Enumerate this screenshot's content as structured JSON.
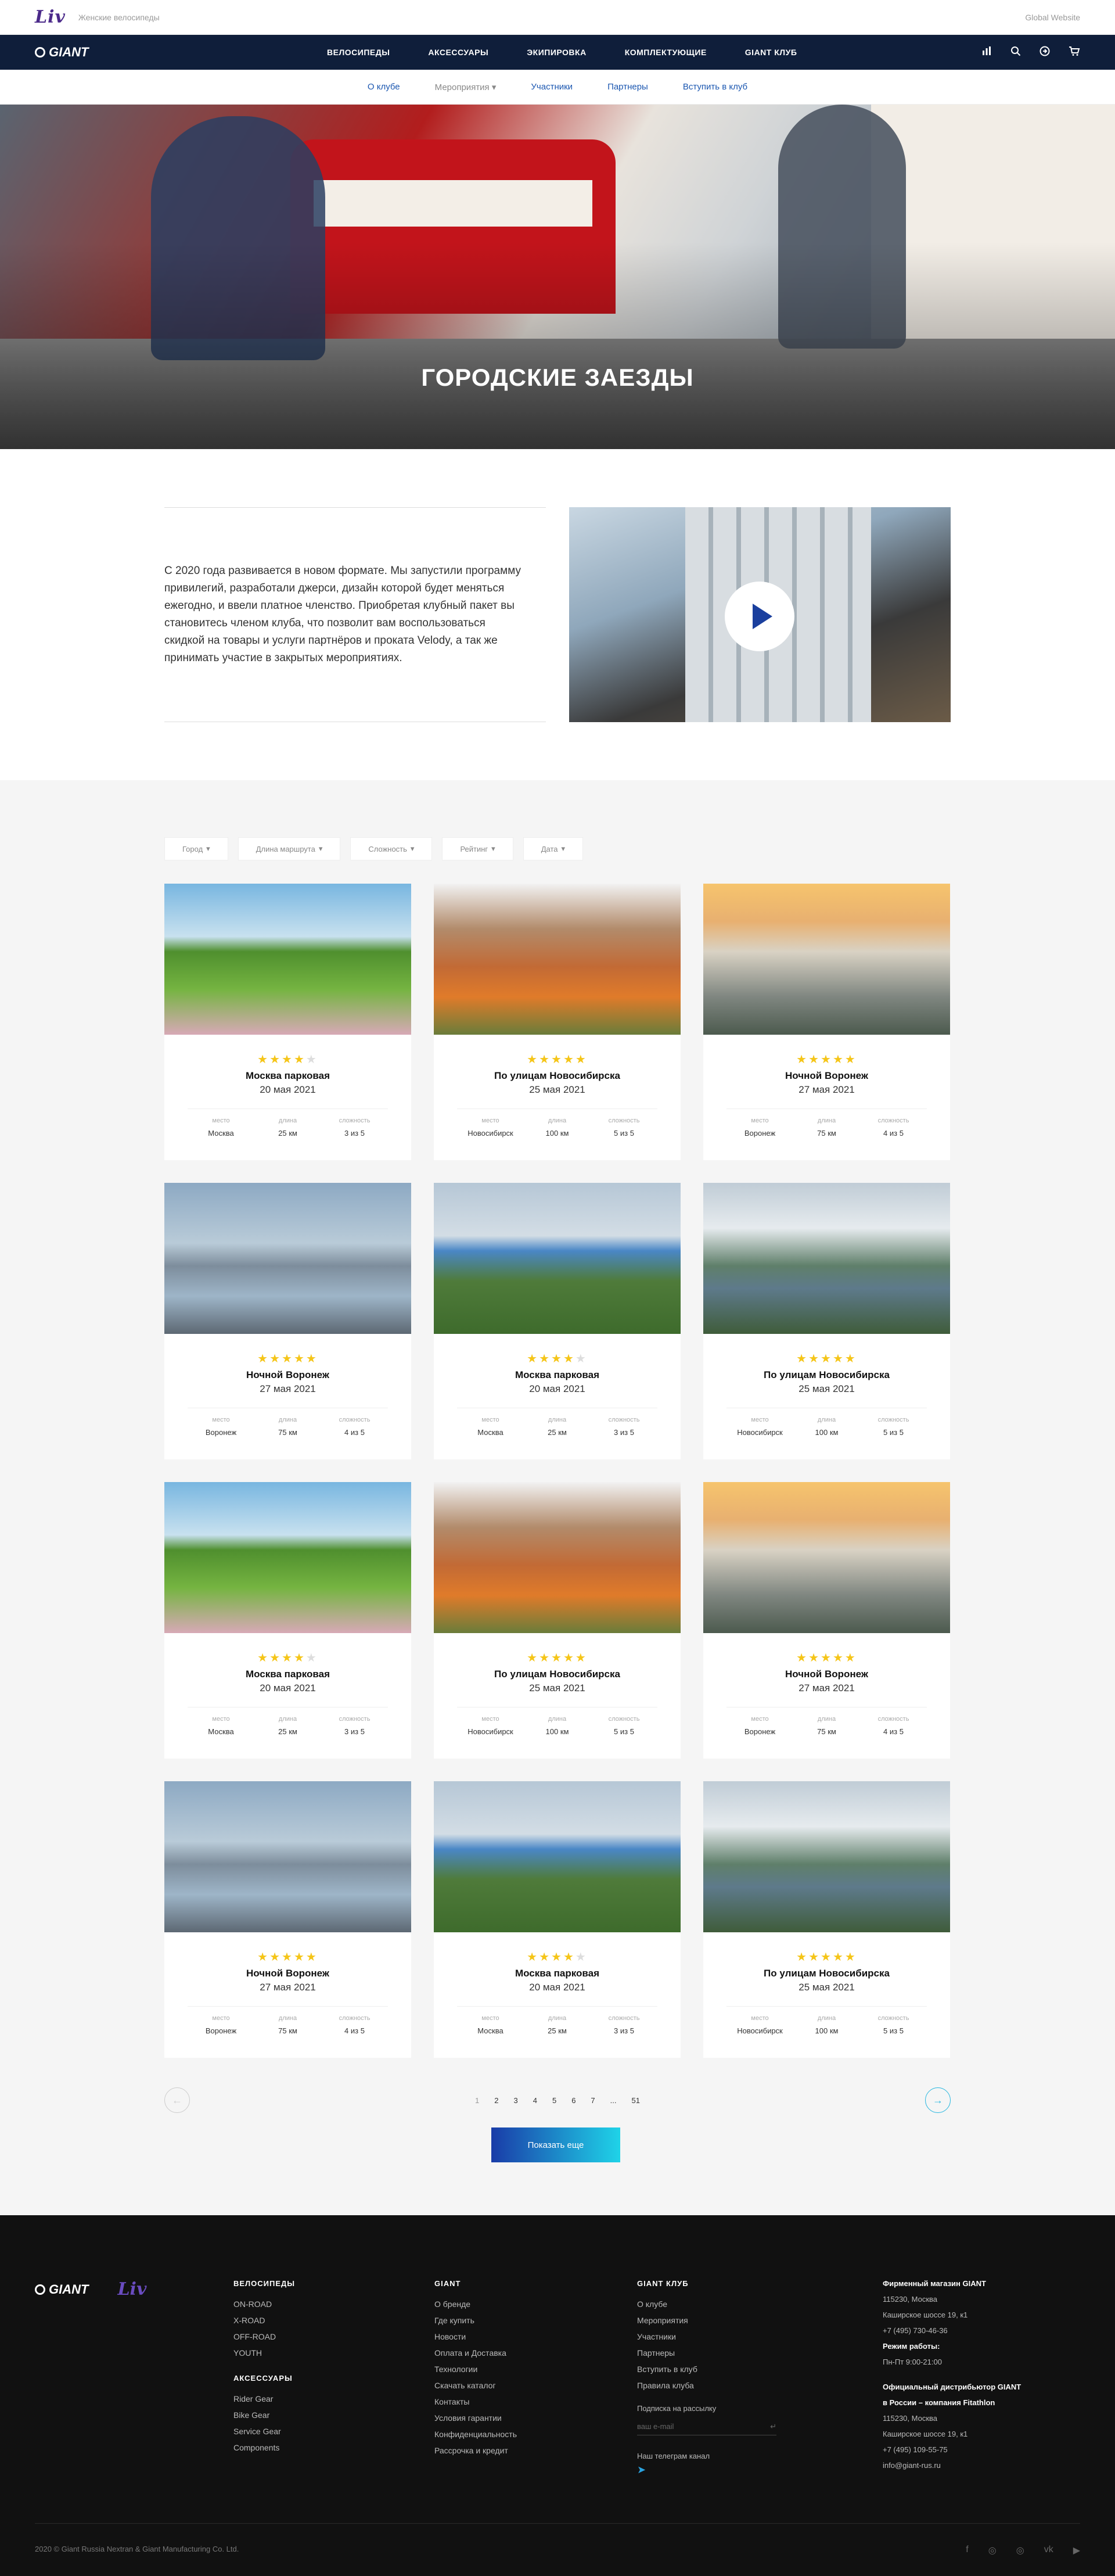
{
  "topbar": {
    "brand": "Liv",
    "subtitle": "Женские велосипеды",
    "global_link": "Global Website"
  },
  "mainnav": {
    "brand": "GIANT",
    "items": [
      "ВЕЛОСИПЕДЫ",
      "АКСЕССУАРЫ",
      "ЭКИПИРОВКА",
      "КОМПЛЕКТУЮЩИЕ",
      "GIANT КЛУБ"
    ],
    "icons": [
      "compare-icon",
      "search-icon",
      "account-icon",
      "cart-icon"
    ]
  },
  "subnav": {
    "items": [
      "О клубе",
      "Мероприятия",
      "Участники",
      "Партнеры",
      "Вступить в клуб"
    ],
    "dropdown_mark": "▾"
  },
  "hero": {
    "title": "ГОРОДСКИЕ ЗАЕЗДЫ"
  },
  "about": {
    "text": "С 2020 года развивается в новом формате. Мы запустили программу привилегий, разработали джерси, дизайн которой будет меняться ежегодно, и ввели платное членство. Приобретая клубный пакет вы становитесь членом клуба, что позволит вам воспользоваться скидкой на товары и услуги партнёров и проката Velody, а так же принимать участие в закрытых мероприятиях."
  },
  "filters": [
    {
      "label": "Город",
      "arrow": "▾"
    },
    {
      "label": "Длина маршрута",
      "arrow": "▾"
    },
    {
      "label": "Сложность",
      "arrow": "▾"
    },
    {
      "label": "Рейтинг",
      "arrow": "▾"
    },
    {
      "label": "Дата",
      "arrow": "▾"
    }
  ],
  "labels": {
    "place": "место",
    "length": "длина",
    "difficulty": "сложность"
  },
  "cards": [
    {
      "image": "park",
      "rating": 4,
      "name": "Москва парковая",
      "date": "20 мая 2021",
      "place": "Москва",
      "length": "25 км",
      "difficulty": "3 из 5"
    },
    {
      "image": "novo",
      "rating": 5,
      "name": "По улицам Новосибирска",
      "date": "25 мая 2021",
      "place": "Новосибирск",
      "length": "100 км",
      "difficulty": "5 из 5"
    },
    {
      "image": "vor",
      "rating": 5,
      "name": "Ночной Воронеж",
      "date": "27 мая 2021",
      "place": "Воронеж",
      "length": "75 км",
      "difficulty": "4 из 5"
    },
    {
      "image": "night",
      "rating": 5,
      "name": "Ночной Воронеж",
      "date": "27 мая 2021",
      "place": "Воронеж",
      "length": "75 км",
      "difficulty": "4 из 5"
    },
    {
      "image": "mosc2",
      "rating": 4,
      "name": "Москва парковая",
      "date": "20 мая 2021",
      "place": "Москва",
      "length": "25 км",
      "difficulty": "3 из 5"
    },
    {
      "image": "novo2",
      "rating": 5,
      "name": "По улицам Новосибирска",
      "date": "25 мая 2021",
      "place": "Новосибирск",
      "length": "100 км",
      "difficulty": "5 из 5"
    },
    {
      "image": "park",
      "rating": 4,
      "name": "Москва парковая",
      "date": "20 мая 2021",
      "place": "Москва",
      "length": "25 км",
      "difficulty": "3 из 5"
    },
    {
      "image": "novo",
      "rating": 5,
      "name": "По улицам Новосибирска",
      "date": "25 мая 2021",
      "place": "Новосибирск",
      "length": "100 км",
      "difficulty": "5 из 5"
    },
    {
      "image": "vor",
      "rating": 5,
      "name": "Ночной Воронеж",
      "date": "27 мая 2021",
      "place": "Воронеж",
      "length": "75 км",
      "difficulty": "4 из 5"
    },
    {
      "image": "night",
      "rating": 5,
      "name": "Ночной Воронеж",
      "date": "27 мая 2021",
      "place": "Воронеж",
      "length": "75 км",
      "difficulty": "4 из 5"
    },
    {
      "image": "mosc2",
      "rating": 4,
      "name": "Москва парковая",
      "date": "20 мая 2021",
      "place": "Москва",
      "length": "25 км",
      "difficulty": "3 из 5"
    },
    {
      "image": "novo2",
      "rating": 5,
      "name": "По улицам Новосибирска",
      "date": "25 мая 2021",
      "place": "Новосибирск",
      "length": "100 км",
      "difficulty": "5 из 5"
    }
  ],
  "pagination": {
    "pages": [
      "1",
      "2",
      "3",
      "4",
      "5",
      "6",
      "7",
      "...",
      "51"
    ],
    "current": "1",
    "prev": "←",
    "next": "→"
  },
  "more_button": "Показать еще",
  "footer": {
    "brand_giant": "GIANT",
    "brand_liv": "Liv",
    "bikes": {
      "title": "ВЕЛОСИПЕДЫ",
      "items": [
        "ON-ROAD",
        "X-ROAD",
        "OFF-ROAD",
        "YOUTH"
      ]
    },
    "accessories": {
      "title": "АКСЕССУАРЫ",
      "items": [
        "Rider Gear",
        "Bike Gear",
        "Service Gear",
        "Components"
      ]
    },
    "giant": {
      "title": "GIANT",
      "items": [
        "О бренде",
        "Где купить",
        "Новости",
        "Оплата и Доставка",
        "Технологии",
        "Скачать каталог",
        "Контакты",
        "Условия гарантии",
        "Конфиденциальность",
        "Рассрочка и кредит"
      ]
    },
    "club": {
      "title": "GIANT КЛУБ",
      "items": [
        "О клубе",
        "Мероприятия",
        "Участники",
        "Партнеры",
        "Вступить в клуб",
        "Правила клуба"
      ]
    },
    "subscribe": {
      "label": "Подписка на рассылку",
      "placeholder": "ваш e-mail",
      "submit": "↵"
    },
    "telegram": {
      "label": "Наш телеграм канал",
      "icon": "➤"
    },
    "store": {
      "title": "Фирменный магазин GIANT",
      "lines": [
        "115230, Москва",
        "Каширское шоссе 19, к1",
        "+7 (495) 730-46-36"
      ],
      "hours_title": "Режим работы:",
      "hours": "Пн-Пт 9:00-21:00"
    },
    "distributor": {
      "title_1": "Официальный дистрибьютор GIANT",
      "title_2": "в России – компания Fitathlon",
      "lines": [
        "115230, Москва",
        "Каширское шоссе 19, к1",
        "+7 (495) 109-55-75",
        "info@giant-rus.ru"
      ]
    },
    "copyright": "2020 © Giant Russia Nextran & Giant Manufacturing Co. Ltd.",
    "social": [
      "facebook-icon",
      "instagram-icon",
      "instagram-icon",
      "vk-icon",
      "youtube-icon"
    ]
  },
  "colors": {
    "nav": "#0f1e3a",
    "accent": "#1a56b0",
    "star": "#f5c518",
    "button_from": "#1a3ca8",
    "button_to": "#1fd3e8",
    "footer": "#111111"
  }
}
